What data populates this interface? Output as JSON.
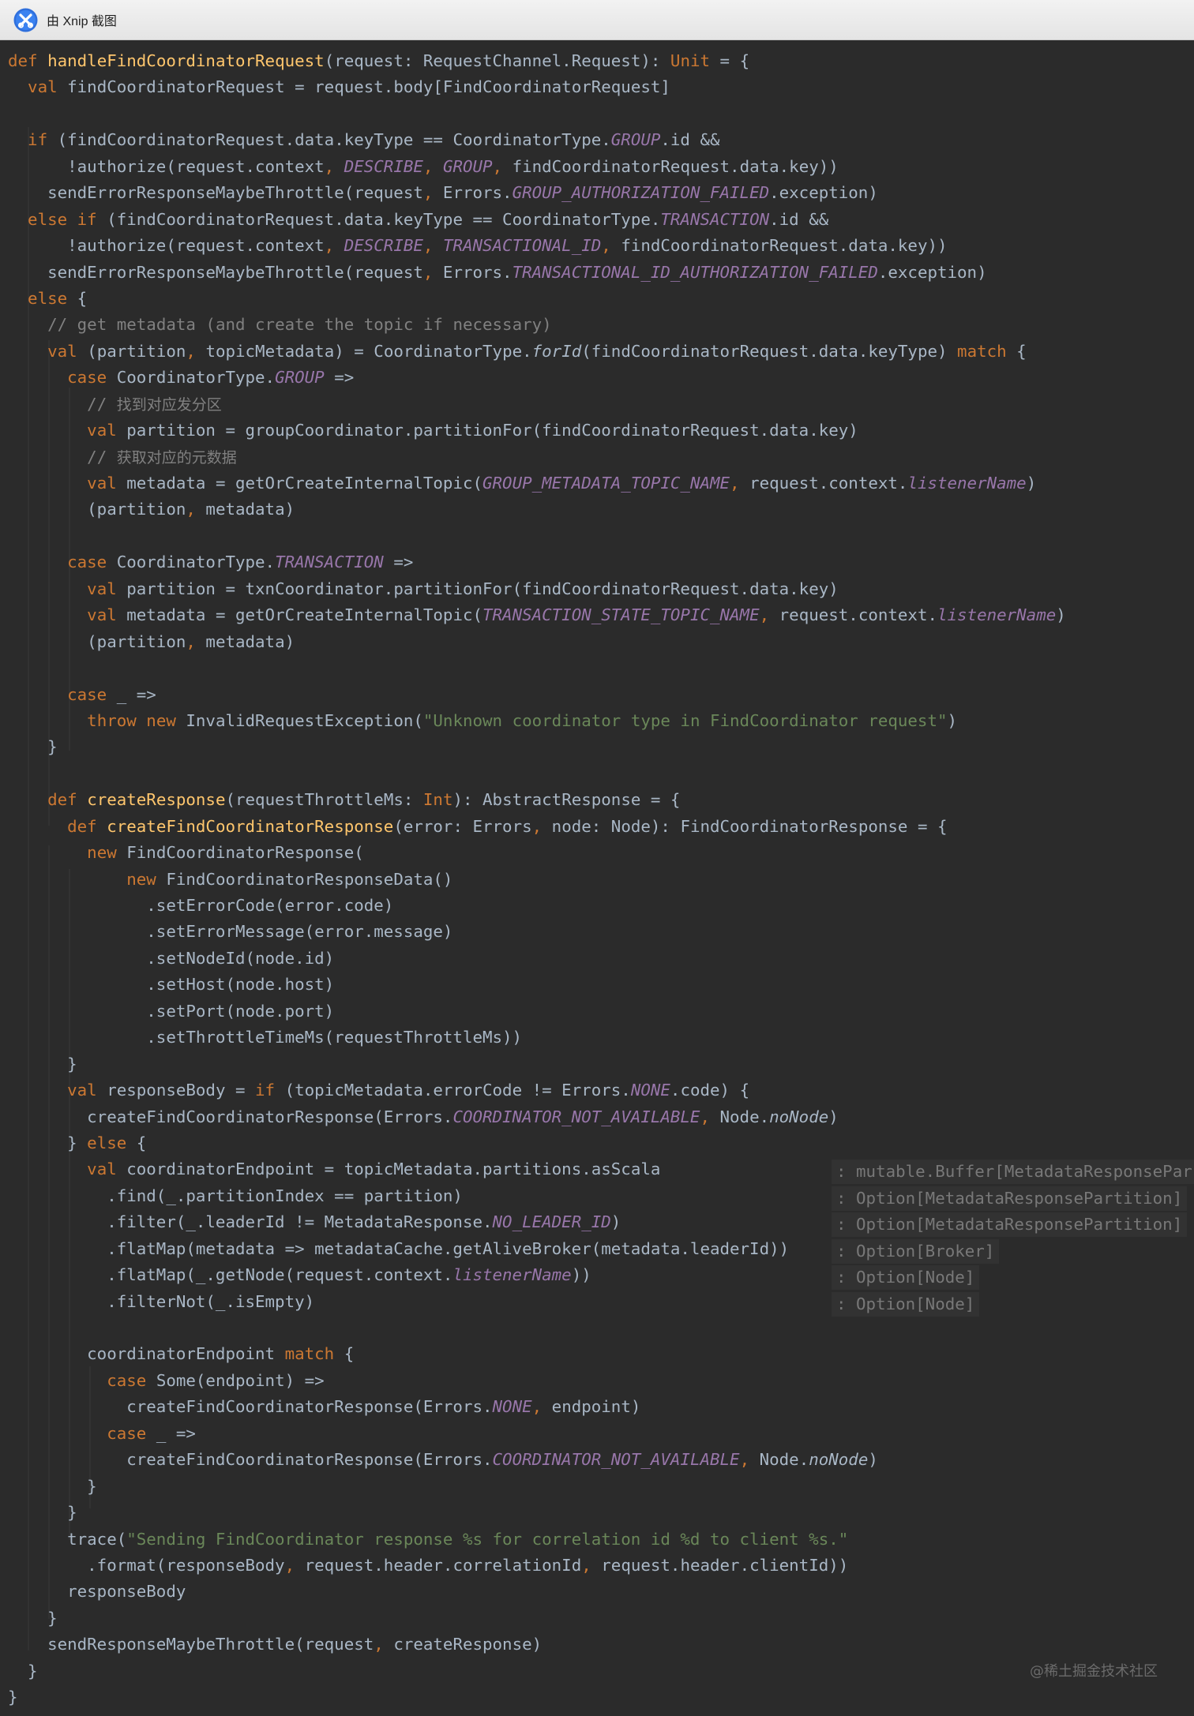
{
  "window": {
    "title": "由 Xnip 截图",
    "icon": "xnip-icon"
  },
  "inlay_hints": [
    ": mutable.Buffer[MetadataResponsePar",
    ": Option[MetadataResponsePartition]",
    ": Option[MetadataResponsePartition]",
    ": Option[Broker]",
    ": Option[Node]",
    ": Option[Node]"
  ],
  "watermark": "@稀土掘金技术社区",
  "theme": {
    "background": "#2b2b2b",
    "keyword": "#cc7832",
    "function": "#ffc66d",
    "constant": "#9876aa",
    "string": "#6a8759",
    "comment": "#808080",
    "plain": "#a9b7c6"
  },
  "code": {
    "lines": [
      [
        [
          "kw",
          "def "
        ],
        [
          "fn",
          "handleFindCoordinatorRequest"
        ],
        [
          "",
          "(request: RequestChannel.Request): "
        ],
        [
          "kw",
          "Unit"
        ],
        [
          "",
          " = {"
        ]
      ],
      [
        [
          "",
          "  "
        ],
        [
          "kw",
          "val "
        ],
        [
          "",
          "findCoordinatorRequest = request.body[FindCoordinatorRequest]"
        ]
      ],
      [],
      [
        [
          "",
          "  "
        ],
        [
          "kw",
          "if "
        ],
        [
          "",
          "(findCoordinatorRequest.data.keyType == CoordinatorType."
        ],
        [
          "cst",
          "GROUP"
        ],
        [
          "",
          ".id &&"
        ]
      ],
      [
        [
          "",
          "      !authorize(request.context"
        ],
        [
          "kw",
          ", "
        ],
        [
          "cst",
          "DESCRIBE"
        ],
        [
          "kw",
          ", "
        ],
        [
          "cst",
          "GROUP"
        ],
        [
          "kw",
          ", "
        ],
        [
          "",
          "findCoordinatorRequest.data.key))"
        ]
      ],
      [
        [
          "",
          "    sendErrorResponseMaybeThrottle(request"
        ],
        [
          "kw",
          ", "
        ],
        [
          "",
          "Errors."
        ],
        [
          "cst",
          "GROUP_AUTHORIZATION_FAILED"
        ],
        [
          "",
          ".exception)"
        ]
      ],
      [
        [
          "",
          "  "
        ],
        [
          "kw",
          "else if "
        ],
        [
          "",
          "(findCoordinatorRequest.data.keyType == CoordinatorType."
        ],
        [
          "cst",
          "TRANSACTION"
        ],
        [
          "",
          ".id &&"
        ]
      ],
      [
        [
          "",
          "      !authorize(request.context"
        ],
        [
          "kw",
          ", "
        ],
        [
          "cst",
          "DESCRIBE"
        ],
        [
          "kw",
          ", "
        ],
        [
          "cst",
          "TRANSACTIONAL_ID"
        ],
        [
          "kw",
          ", "
        ],
        [
          "",
          "findCoordinatorRequest.data.key))"
        ]
      ],
      [
        [
          "",
          "    sendErrorResponseMaybeThrottle(request"
        ],
        [
          "kw",
          ", "
        ],
        [
          "",
          "Errors."
        ],
        [
          "cst",
          "TRANSACTIONAL_ID_AUTHORIZATION_FAILED"
        ],
        [
          "",
          ".exception)"
        ]
      ],
      [
        [
          "",
          "  "
        ],
        [
          "kw",
          "else "
        ],
        [
          "",
          "{"
        ]
      ],
      [
        [
          "",
          "    "
        ],
        [
          "cmt",
          "// get metadata (and create the topic if necessary)"
        ]
      ],
      [
        [
          "",
          "    "
        ],
        [
          "kw",
          "val "
        ],
        [
          "",
          "(partition"
        ],
        [
          "kw",
          ", "
        ],
        [
          "",
          "topicMetadata) = CoordinatorType."
        ],
        [
          "it",
          "forId"
        ],
        [
          "",
          "(findCoordinatorRequest.data.keyType) "
        ],
        [
          "kw",
          "match "
        ],
        [
          "",
          "{"
        ]
      ],
      [
        [
          "",
          "      "
        ],
        [
          "kw",
          "case "
        ],
        [
          "",
          "CoordinatorType."
        ],
        [
          "cst",
          "GROUP"
        ],
        [
          "",
          " =>"
        ]
      ],
      [
        [
          "",
          "        "
        ],
        [
          "cmt",
          "// "
        ],
        [
          "cn",
          "找到对应发分区"
        ]
      ],
      [
        [
          "",
          "        "
        ],
        [
          "kw",
          "val "
        ],
        [
          "",
          "partition = groupCoordinator.partitionFor(findCoordinatorRequest.data.key)"
        ]
      ],
      [
        [
          "",
          "        "
        ],
        [
          "cmt",
          "// "
        ],
        [
          "cn",
          "获取对应的元数据"
        ]
      ],
      [
        [
          "",
          "        "
        ],
        [
          "kw",
          "val "
        ],
        [
          "",
          "metadata = getOrCreateInternalTopic("
        ],
        [
          "cst",
          "GROUP_METADATA_TOPIC_NAME"
        ],
        [
          "kw",
          ", "
        ],
        [
          "",
          "request.context."
        ],
        [
          "cst",
          "listenerName"
        ],
        [
          "",
          ")"
        ]
      ],
      [
        [
          "",
          "        (partition"
        ],
        [
          "kw",
          ", "
        ],
        [
          "",
          "metadata)"
        ]
      ],
      [],
      [
        [
          "",
          "      "
        ],
        [
          "kw",
          "case "
        ],
        [
          "",
          "CoordinatorType."
        ],
        [
          "cst",
          "TRANSACTION"
        ],
        [
          "",
          " =>"
        ]
      ],
      [
        [
          "",
          "        "
        ],
        [
          "kw",
          "val "
        ],
        [
          "",
          "partition = txnCoordinator.partitionFor(findCoordinatorRequest.data.key)"
        ]
      ],
      [
        [
          "",
          "        "
        ],
        [
          "kw",
          "val "
        ],
        [
          "",
          "metadata = getOrCreateInternalTopic("
        ],
        [
          "cst",
          "TRANSACTION_STATE_TOPIC_NAME"
        ],
        [
          "kw",
          ", "
        ],
        [
          "",
          "request.context."
        ],
        [
          "cst",
          "listenerName"
        ],
        [
          "",
          ")"
        ]
      ],
      [
        [
          "",
          "        (partition"
        ],
        [
          "kw",
          ", "
        ],
        [
          "",
          "metadata)"
        ]
      ],
      [],
      [
        [
          "",
          "      "
        ],
        [
          "kw",
          "case "
        ],
        [
          "",
          "_ =>"
        ]
      ],
      [
        [
          "",
          "        "
        ],
        [
          "kw",
          "throw new "
        ],
        [
          "",
          "InvalidRequestException("
        ],
        [
          "str",
          "\"Unknown coordinator type in FindCoordinator request\""
        ],
        [
          "",
          ")"
        ]
      ],
      [
        [
          "",
          "    }"
        ]
      ],
      [],
      [
        [
          "",
          "    "
        ],
        [
          "kw",
          "def "
        ],
        [
          "fn",
          "createResponse"
        ],
        [
          "",
          "(requestThrottleMs: "
        ],
        [
          "kw",
          "Int"
        ],
        [
          "",
          "): AbstractResponse = {"
        ]
      ],
      [
        [
          "",
          "      "
        ],
        [
          "kw",
          "def "
        ],
        [
          "fn",
          "createFindCoordinatorResponse"
        ],
        [
          "",
          "(error: Errors"
        ],
        [
          "kw",
          ", "
        ],
        [
          "",
          "node: Node): FindCoordinatorResponse = {"
        ]
      ],
      [
        [
          "",
          "        "
        ],
        [
          "kw",
          "new "
        ],
        [
          "",
          "FindCoordinatorResponse("
        ]
      ],
      [
        [
          "",
          "            "
        ],
        [
          "kw",
          "new "
        ],
        [
          "",
          "FindCoordinatorResponseData()"
        ]
      ],
      [
        [
          "",
          "              .setErrorCode(error.code)"
        ]
      ],
      [
        [
          "",
          "              .setErrorMessage(error.message)"
        ]
      ],
      [
        [
          "",
          "              .setNodeId(node.id)"
        ]
      ],
      [
        [
          "",
          "              .setHost(node.host)"
        ]
      ],
      [
        [
          "",
          "              .setPort(node.port)"
        ]
      ],
      [
        [
          "",
          "              .setThrottleTimeMs(requestThrottleMs))"
        ]
      ],
      [
        [
          "",
          "      }"
        ]
      ],
      [
        [
          "",
          "      "
        ],
        [
          "kw",
          "val "
        ],
        [
          "",
          "responseBody = "
        ],
        [
          "kw",
          "if "
        ],
        [
          "",
          "(topicMetadata.errorCode != Errors."
        ],
        [
          "cst",
          "NONE"
        ],
        [
          "",
          ".code) {"
        ]
      ],
      [
        [
          "",
          "        createFindCoordinatorResponse(Errors."
        ],
        [
          "cst",
          "COORDINATOR_NOT_AVAILABLE"
        ],
        [
          "kw",
          ", "
        ],
        [
          "",
          "Node."
        ],
        [
          "it",
          "noNode"
        ],
        [
          "",
          ")"
        ]
      ],
      [
        [
          "",
          "      } "
        ],
        [
          "kw",
          "else "
        ],
        [
          "",
          "{"
        ]
      ],
      [
        [
          "",
          "        "
        ],
        [
          "kw",
          "val "
        ],
        [
          "",
          "coordinatorEndpoint = topicMetadata.partitions.asScala"
        ]
      ],
      [
        [
          "",
          "          .find(_.partitionIndex == partition)"
        ]
      ],
      [
        [
          "",
          "          .filter(_.leaderId != MetadataResponse."
        ],
        [
          "cst",
          "NO_LEADER_ID"
        ],
        [
          "",
          ")"
        ]
      ],
      [
        [
          "",
          "          .flatMap(metadata => metadataCache.getAliveBroker(metadata.leaderId))"
        ]
      ],
      [
        [
          "",
          "          .flatMap(_.getNode(request.context."
        ],
        [
          "cst",
          "listenerName"
        ],
        [
          "",
          "))"
        ]
      ],
      [
        [
          "",
          "          .filterNot(_.isEmpty)"
        ]
      ],
      [],
      [
        [
          "",
          "        coordinatorEndpoint "
        ],
        [
          "kw",
          "match "
        ],
        [
          "",
          "{"
        ]
      ],
      [
        [
          "",
          "          "
        ],
        [
          "kw",
          "case "
        ],
        [
          "",
          "Some(endpoint) =>"
        ]
      ],
      [
        [
          "",
          "            createFindCoordinatorResponse(Errors."
        ],
        [
          "cst",
          "NONE"
        ],
        [
          "kw",
          ", "
        ],
        [
          "",
          "endpoint)"
        ]
      ],
      [
        [
          "",
          "          "
        ],
        [
          "kw",
          "case "
        ],
        [
          "",
          "_ =>"
        ]
      ],
      [
        [
          "",
          "            createFindCoordinatorResponse(Errors."
        ],
        [
          "cst",
          "COORDINATOR_NOT_AVAILABLE"
        ],
        [
          "kw",
          ", "
        ],
        [
          "",
          "Node."
        ],
        [
          "it",
          "noNode"
        ],
        [
          "",
          ")"
        ]
      ],
      [
        [
          "",
          "        }"
        ]
      ],
      [
        [
          "",
          "      }"
        ]
      ],
      [
        [
          "",
          "      trace("
        ],
        [
          "str",
          "\"Sending FindCoordinator response %s for correlation id %d to client %s.\""
        ]
      ],
      [
        [
          "",
          "        .format(responseBody"
        ],
        [
          "kw",
          ", "
        ],
        [
          "",
          "request.header.correlationId"
        ],
        [
          "kw",
          ", "
        ],
        [
          "",
          "request.header.clientId))"
        ]
      ],
      [
        [
          "",
          "      responseBody"
        ]
      ],
      [
        [
          "",
          "    }"
        ]
      ],
      [
        [
          "",
          "    sendResponseMaybeThrottle(request"
        ],
        [
          "kw",
          ", "
        ],
        [
          "",
          "createResponse)"
        ]
      ],
      [
        [
          "",
          "  }"
        ]
      ],
      [
        [
          "",
          "}"
        ]
      ]
    ]
  }
}
